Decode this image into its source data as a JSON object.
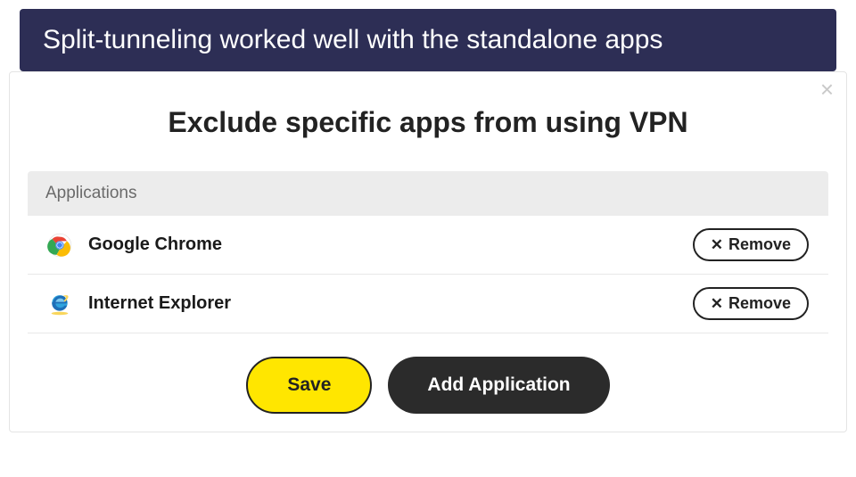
{
  "banner": "Split-tunneling worked well with the standalone apps",
  "dialog": {
    "title": "Exclude specific apps from using VPN",
    "section_label": "Applications",
    "apps": [
      {
        "name": "Google Chrome",
        "icon": "chrome"
      },
      {
        "name": "Internet Explorer",
        "icon": "ie"
      }
    ],
    "remove_label": "Remove",
    "save_label": "Save",
    "add_label": "Add Application",
    "close_label": "×"
  }
}
